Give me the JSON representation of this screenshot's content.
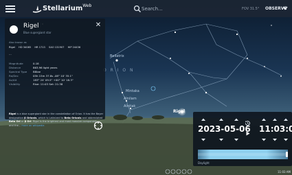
{
  "header": {
    "app_name": "Stellarium",
    "app_suffix": "Web",
    "search_placeholder": "Search...",
    "fov": "FOV 31.5°",
    "observe_label": "OBSERVE"
  },
  "sky": {
    "labels": [
      "Bellatrix",
      "O R I O N",
      "Mintaka",
      "Alnilam",
      "Alnitak",
      "Rigel"
    ]
  },
  "info": {
    "name": "Rigel",
    "type": "Blue supergiant star",
    "also_known_as_label": "Also known as",
    "aka_row1": [
      "Rigel",
      "HD 34085",
      "HR 1713",
      "SAO 131907",
      "HIP 24436"
    ],
    "aka_more": "...",
    "props": [
      {
        "label": "Magnitude",
        "value": "0.18"
      },
      {
        "label": "Distance",
        "value": "863.96 light years"
      },
      {
        "label": "Spectral Type",
        "value": "B8Iae"
      },
      {
        "label": "Ra/Dec",
        "value": "05h 15m 37.8s   -08° 10' 35.1\""
      },
      {
        "label": "Az/Alt",
        "value": "183° 24' 09.5\"   +00° 10' 18.3\""
      },
      {
        "label": "Visibility",
        "value": "Rise: 11:03   Set: 21:38"
      }
    ],
    "desc_name": "Rigel",
    "desc_text1": " is a blue supergiant star in the constellation of Orion. It has the Bayer designation ",
    "desc_bayer": "β Orionis",
    "desc_text2": ", which is Latinized to ",
    "desc_bayer_latin": "Beta Orionis",
    "desc_text3": " and abbreviated ",
    "desc_abbrev": "Beta Ori",
    "desc_text4": " or ",
    "desc_abbrev2": "β Ori",
    "desc_text5": ". Rigel is the brightest and most massive component – and the... ",
    "desc_more": "more on wikipedia"
  },
  "datetime": {
    "date": "2023-05-06",
    "time": "11:03:00",
    "timeline_label": "Daylight",
    "timeline_position": 0.99
  },
  "status": {
    "clock": "11:03 AM"
  },
  "colors": {
    "daylight": "#8fd0ef",
    "night": "#2a4358",
    "link": "#55a5dc"
  }
}
